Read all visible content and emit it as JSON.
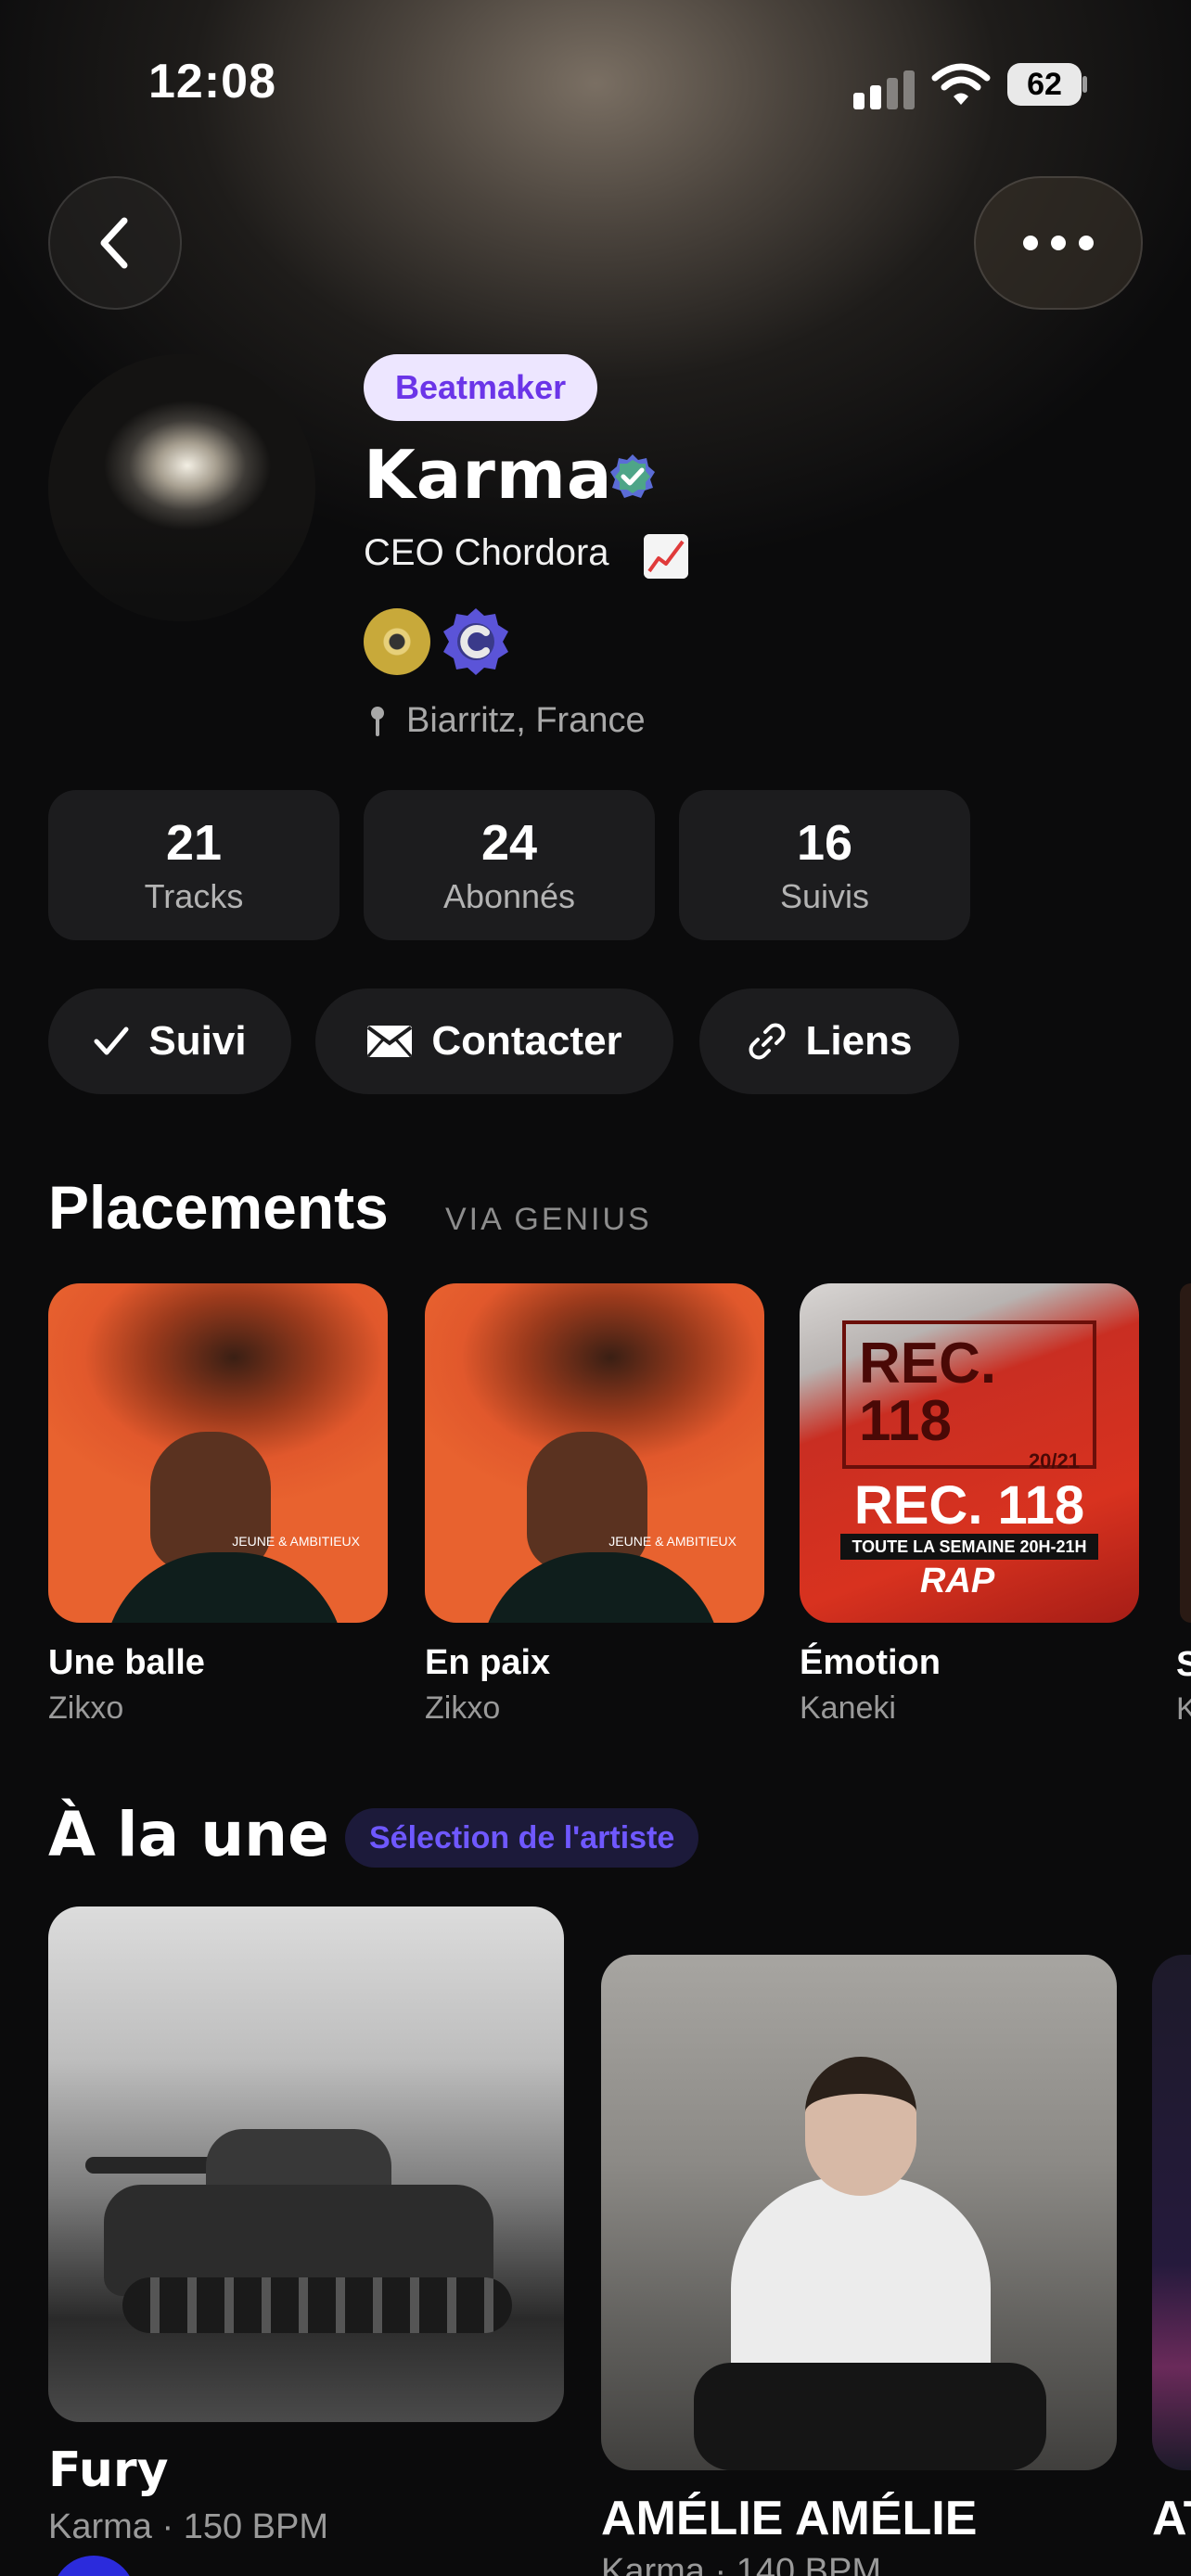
{
  "status_bar": {
    "time": "12:08",
    "battery": "62"
  },
  "profile": {
    "role": "Beatmaker",
    "name": "Karma",
    "bio": "CEO Chordora",
    "location": "Biarritz, France"
  },
  "stats": [
    {
      "value": "21",
      "label": "Tracks"
    },
    {
      "value": "24",
      "label": "Abonnés"
    },
    {
      "value": "16",
      "label": "Suivis"
    }
  ],
  "actions": {
    "follow": "Suivi",
    "contact": "Contacter",
    "links": "Liens"
  },
  "placements": {
    "title": "Placements",
    "subtitle": "VIA GENIUS",
    "items": [
      {
        "title": "Une balle",
        "artist": "Zikxo"
      },
      {
        "title": "En paix",
        "artist": "Zikxo"
      },
      {
        "title": "Émotion",
        "artist": "Kaneki"
      }
    ],
    "partial_title": "S",
    "partial_artist": "K"
  },
  "rec_cover": {
    "box": "REC. 118",
    "box_date": "20/21",
    "title": "REC. 118",
    "strip": "TOUTE LA SEMAINE 20H-21H",
    "rap": "RAP"
  },
  "featured": {
    "title": "À la une",
    "badge": "Sélection de l'artiste",
    "items": [
      {
        "title": "Fury",
        "meta": "Karma · 150 BPM"
      },
      {
        "title": "AMÉLIE AMÉLIE",
        "meta": "Karma · 140 BPM"
      }
    ],
    "partial_title": "AT"
  },
  "colors": {
    "accent": "#6b35e8",
    "badge_bg": "#ede6ff",
    "card_bg": "#1c1c1e",
    "feature_badge": "#6f58ff"
  }
}
